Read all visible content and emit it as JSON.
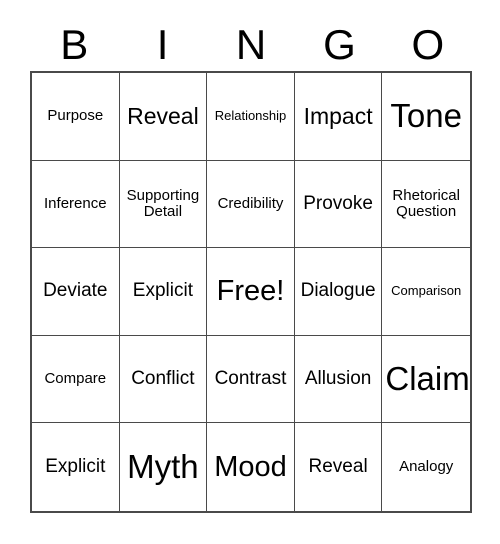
{
  "card": {
    "header_letters": [
      "B",
      "I",
      "N",
      "G",
      "O"
    ],
    "colors": {
      "text": "#000000",
      "grid_line": "#4a4a4a",
      "background": "#ffffff"
    },
    "grid": {
      "rows": 5,
      "columns": 5,
      "free_space_index": 12
    },
    "cells": [
      {
        "text": "Purpose",
        "size": "sm"
      },
      {
        "text": "Reveal",
        "size": "lg"
      },
      {
        "text": "Relationship",
        "size": "xs"
      },
      {
        "text": "Impact",
        "size": "lg"
      },
      {
        "text": "Tone",
        "size": "xxl"
      },
      {
        "text": "Inference",
        "size": "sm"
      },
      {
        "text": "Supporting\nDetail",
        "size": "sm"
      },
      {
        "text": "Credibility",
        "size": "sm"
      },
      {
        "text": "Provoke",
        "size": "md"
      },
      {
        "text": "Rhetorical\nQuestion",
        "size": "sm"
      },
      {
        "text": "Deviate",
        "size": "md"
      },
      {
        "text": "Explicit",
        "size": "md"
      },
      {
        "text": "Free!",
        "size": "xl"
      },
      {
        "text": "Dialogue",
        "size": "md"
      },
      {
        "text": "Comparison",
        "size": "xs"
      },
      {
        "text": "Compare",
        "size": "sm"
      },
      {
        "text": "Conflict",
        "size": "md"
      },
      {
        "text": "Contrast",
        "size": "md"
      },
      {
        "text": "Allusion",
        "size": "md"
      },
      {
        "text": "Claim",
        "size": "xxl"
      },
      {
        "text": "Explicit",
        "size": "md"
      },
      {
        "text": "Myth",
        "size": "xxl"
      },
      {
        "text": "Mood",
        "size": "xl"
      },
      {
        "text": "Reveal",
        "size": "md"
      },
      {
        "text": "Analogy",
        "size": "sm"
      }
    ]
  }
}
